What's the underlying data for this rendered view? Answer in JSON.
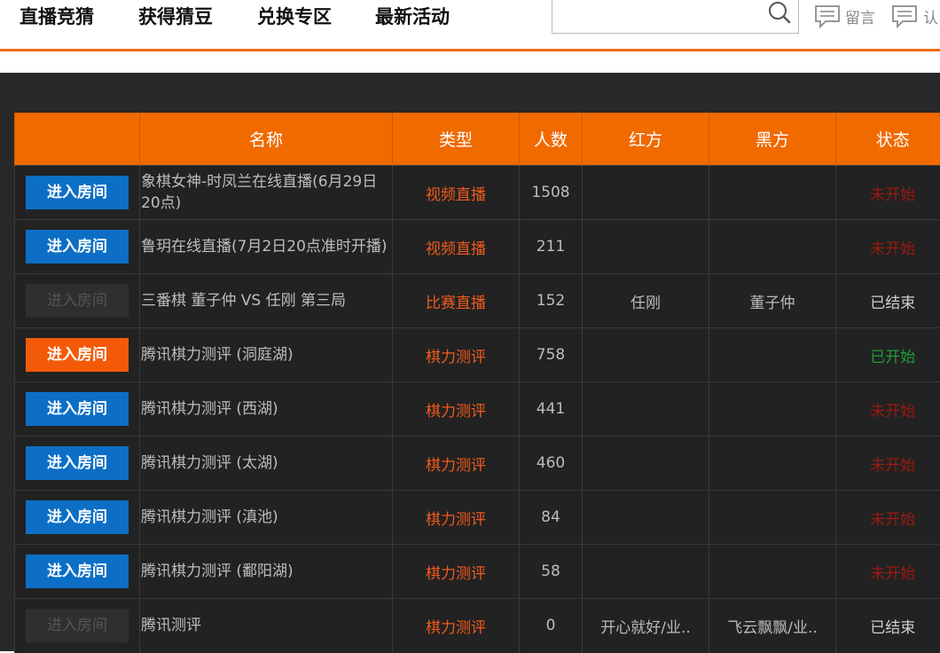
{
  "nav": {
    "items": [
      "直播竞猜",
      "获得猜豆",
      "兑换专区",
      "最新活动"
    ]
  },
  "search": {
    "placeholder": ""
  },
  "topbar": {
    "message_label": "留言",
    "second_label": "认"
  },
  "colors": {
    "accent": "#f06a12",
    "blue_button": "#0c6fc5",
    "active_button": "#f25a0a",
    "not_started": "#9b1a10",
    "started": "#1e9e3a"
  },
  "table": {
    "headers": [
      "",
      "名称",
      "类型",
      "人数",
      "红方",
      "黑方",
      "状态"
    ],
    "rows": [
      {
        "button": "进入房间",
        "button_state": "enabled",
        "name": "象棋女神-时凤兰在线直播(6月29日20点)",
        "type": "视频直播",
        "count": "1508",
        "red": "",
        "black": "",
        "status": "未开始",
        "status_kind": "not"
      },
      {
        "button": "进入房间",
        "button_state": "enabled",
        "name": "鲁玥在线直播(7月2日20点准时开播)",
        "type": "视频直播",
        "count": "211",
        "red": "",
        "black": "",
        "status": "未开始",
        "status_kind": "not"
      },
      {
        "button": "进入房间",
        "button_state": "disabled",
        "name": "三番棋 董子仲 VS 任刚 第三局",
        "type": "比赛直播",
        "count": "152",
        "red": "任刚",
        "black": "董子仲",
        "status": "已结束",
        "status_kind": "end"
      },
      {
        "button": "进入房间",
        "button_state": "active",
        "name": "腾讯棋力测评 (洞庭湖)",
        "type": "棋力测评",
        "count": "758",
        "red": "",
        "black": "",
        "status": "已开始",
        "status_kind": "on"
      },
      {
        "button": "进入房间",
        "button_state": "enabled",
        "name": "腾讯棋力测评 (西湖)",
        "type": "棋力测评",
        "count": "441",
        "red": "",
        "black": "",
        "status": "未开始",
        "status_kind": "not"
      },
      {
        "button": "进入房间",
        "button_state": "enabled",
        "name": "腾讯棋力测评 (太湖)",
        "type": "棋力测评",
        "count": "460",
        "red": "",
        "black": "",
        "status": "未开始",
        "status_kind": "not"
      },
      {
        "button": "进入房间",
        "button_state": "enabled",
        "name": "腾讯棋力测评 (滇池)",
        "type": "棋力测评",
        "count": "84",
        "red": "",
        "black": "",
        "status": "未开始",
        "status_kind": "not"
      },
      {
        "button": "进入房间",
        "button_state": "enabled",
        "name": "腾讯棋力测评 (鄱阳湖)",
        "type": "棋力测评",
        "count": "58",
        "red": "",
        "black": "",
        "status": "未开始",
        "status_kind": "not"
      },
      {
        "button": "进入房间",
        "button_state": "disabled",
        "name": "腾讯测评",
        "type": "棋力测评",
        "count": "0",
        "red": "开心就好/业..",
        "black": "飞云飘飘/业..",
        "status": "已结束",
        "status_kind": "end"
      }
    ]
  }
}
